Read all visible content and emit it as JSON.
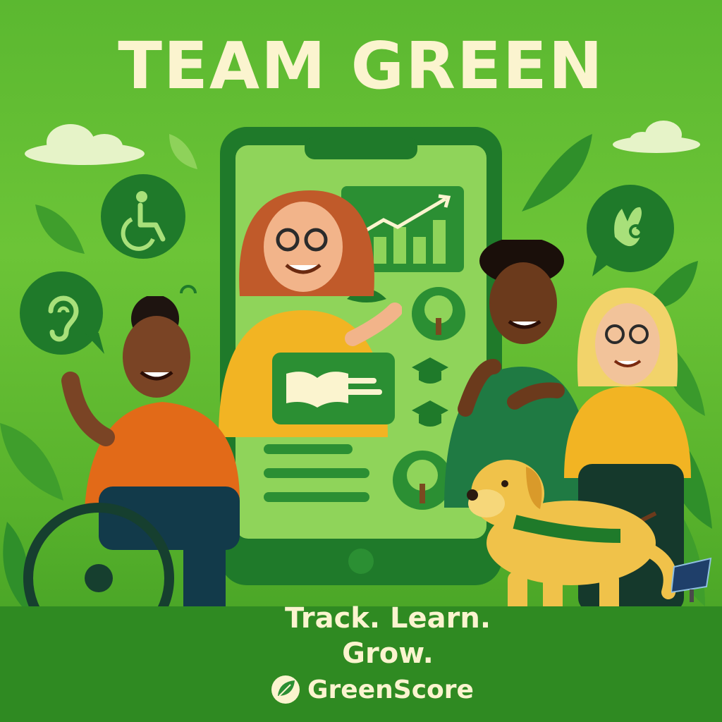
{
  "poster": {
    "title": "TEAM GREEN",
    "tagline_line1": "Track. Learn.",
    "tagline_line2": "Grow.",
    "brand_name": "GreenScore"
  },
  "icons": {
    "accessibility": "wheelchair-icon",
    "hearing": "ear-icon",
    "sign_language": "sign-language-hand-icon",
    "chart": "growth-chart-icon",
    "book": "open-book-icon",
    "tree": "tree-icon",
    "graduation": "graduation-cap-icon",
    "brand_leaf": "leaf-icon"
  },
  "colors": {
    "background": "#6cc437",
    "dark_green": "#1f7a2a",
    "cream_text": "#fbf4cf",
    "phone_screen": "#8fd45a"
  }
}
